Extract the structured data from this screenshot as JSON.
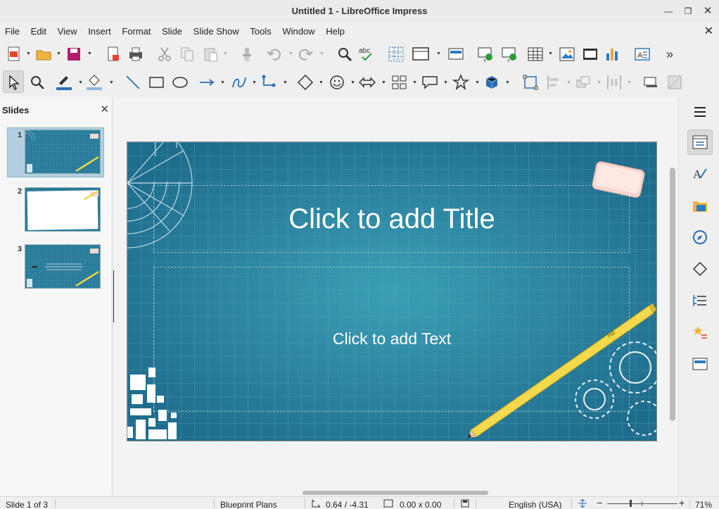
{
  "window": {
    "title": "Untitled 1 - LibreOffice Impress"
  },
  "menu": [
    "File",
    "Edit",
    "View",
    "Insert",
    "Format",
    "Slide",
    "Slide Show",
    "Tools",
    "Window",
    "Help"
  ],
  "slides_pane": {
    "header": "Slides",
    "numbers": [
      "1",
      "2",
      "3"
    ]
  },
  "slide": {
    "title_placeholder": "Click to add Title",
    "text_placeholder": "Click to add Text"
  },
  "status": {
    "slide": "Slide 1 of 3",
    "master": "Blueprint Plans",
    "position": "0.64 / -4.31",
    "size": "0.00 x 0.00",
    "language": "English (USA)",
    "zoom": "71%"
  },
  "colors": {
    "slide_bg": "#2a7b9a",
    "selection": "#b4cfe1",
    "accent": "#e8412c"
  }
}
